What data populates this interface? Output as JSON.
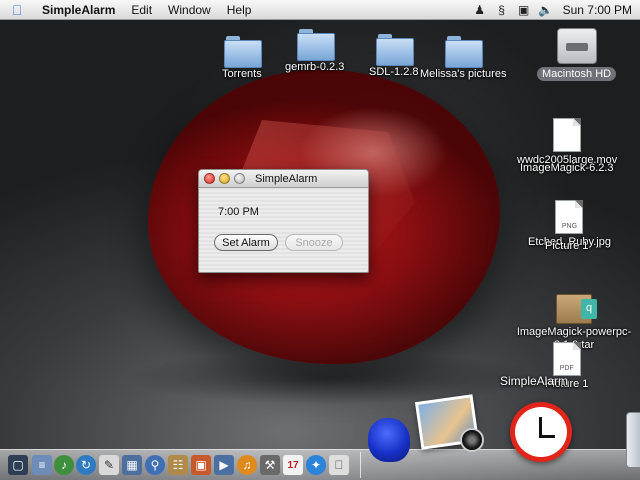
{
  "menubar": {
    "apple_glyph": "",
    "app_name": "SimpleAlarm",
    "menus": [
      "Edit",
      "Window",
      "Help"
    ],
    "status_icons": [
      "user-icon",
      "script-icon",
      "display-icon",
      "volume-icon"
    ],
    "clock": "Sun 7:00 PM"
  },
  "desktop": {
    "folders": [
      {
        "label": "Torrents"
      },
      {
        "label": "gemrb-0.2.3"
      },
      {
        "label": "SDL-1.2.8"
      },
      {
        "label": "Melissa's pictures"
      }
    ],
    "hard_drive": {
      "label": "Macintosh HD"
    },
    "files": [
      {
        "label": "wwdc2005large.mov"
      },
      {
        "label": "ImageMagick-6.2.3"
      },
      {
        "label": "Etched_Ruby.jpg",
        "badge": "PNG"
      },
      {
        "label": "Picture 1"
      },
      {
        "label": "ImageMagick-powerpc-8.1.0.tar"
      },
      {
        "label": "Picture 1",
        "badge": "PDF"
      }
    ]
  },
  "window": {
    "title": "SimpleAlarm",
    "time_text": "7:00 PM",
    "set_alarm_label": "Set Alarm",
    "snooze_label": "Snooze",
    "snooze_enabled": false
  },
  "dock": {
    "hover_label": "SimpleAlarm",
    "calendar_day": "17",
    "colors": {
      "clock_ring": "#e1251b",
      "frog": "#1631c7"
    }
  }
}
